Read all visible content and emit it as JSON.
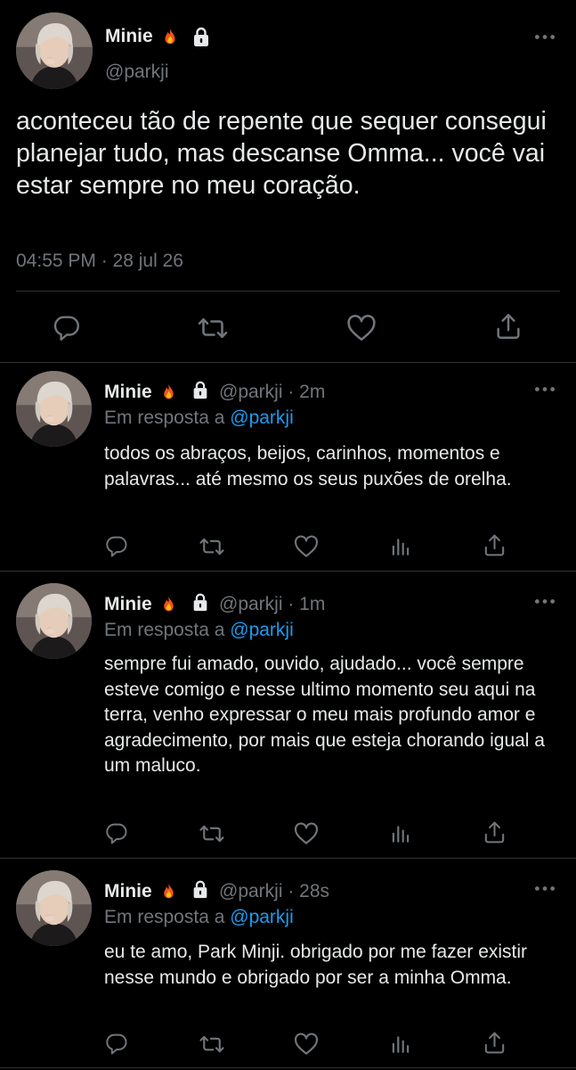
{
  "main_tweet": {
    "name": "Minie",
    "handle": "@parkji",
    "text": "aconteceu tão de repente que sequer consegui planejar tudo, mas descanse Omma... você vai estar sempre no meu coração.",
    "time": "04:55 PM · 28 jul 26",
    "actions": [
      "reply-icon",
      "retweet-icon",
      "like-icon",
      "share-icon"
    ]
  },
  "replies": [
    {
      "name": "Minie",
      "handle_time": "@parkji · 2m",
      "reply_prefix": "Em resposta a",
      "reply_mention": "@parkji",
      "text": "todos os abraços, beijos, carinhos, momentos e palavras... até mesmo os seus puxões de orelha."
    },
    {
      "name": "Minie",
      "handle_time": "@parkji · 1m",
      "reply_prefix": "Em resposta a",
      "reply_mention": "@parkji",
      "text": "sempre fui amado, ouvido, ajudado... você sempre esteve comigo e nesse ultimo momento seu aqui na terra, venho expressar o meu mais profundo amor e agradecimento, por mais que esteja chorando igual a um maluco."
    },
    {
      "name": "Minie",
      "handle_time": "@parkji · 28s",
      "reply_prefix": "Em resposta a",
      "reply_mention": "@parkji",
      "text": "eu te amo, Park Minji. obrigado por me fazer existir nesse mundo e obrigado por ser a minha Omma."
    }
  ],
  "colors": {
    "background": "#000000",
    "text": "#e7e9ea",
    "muted": "#71767b",
    "accent": "#1d9bf0",
    "divider": "#2f3336"
  }
}
